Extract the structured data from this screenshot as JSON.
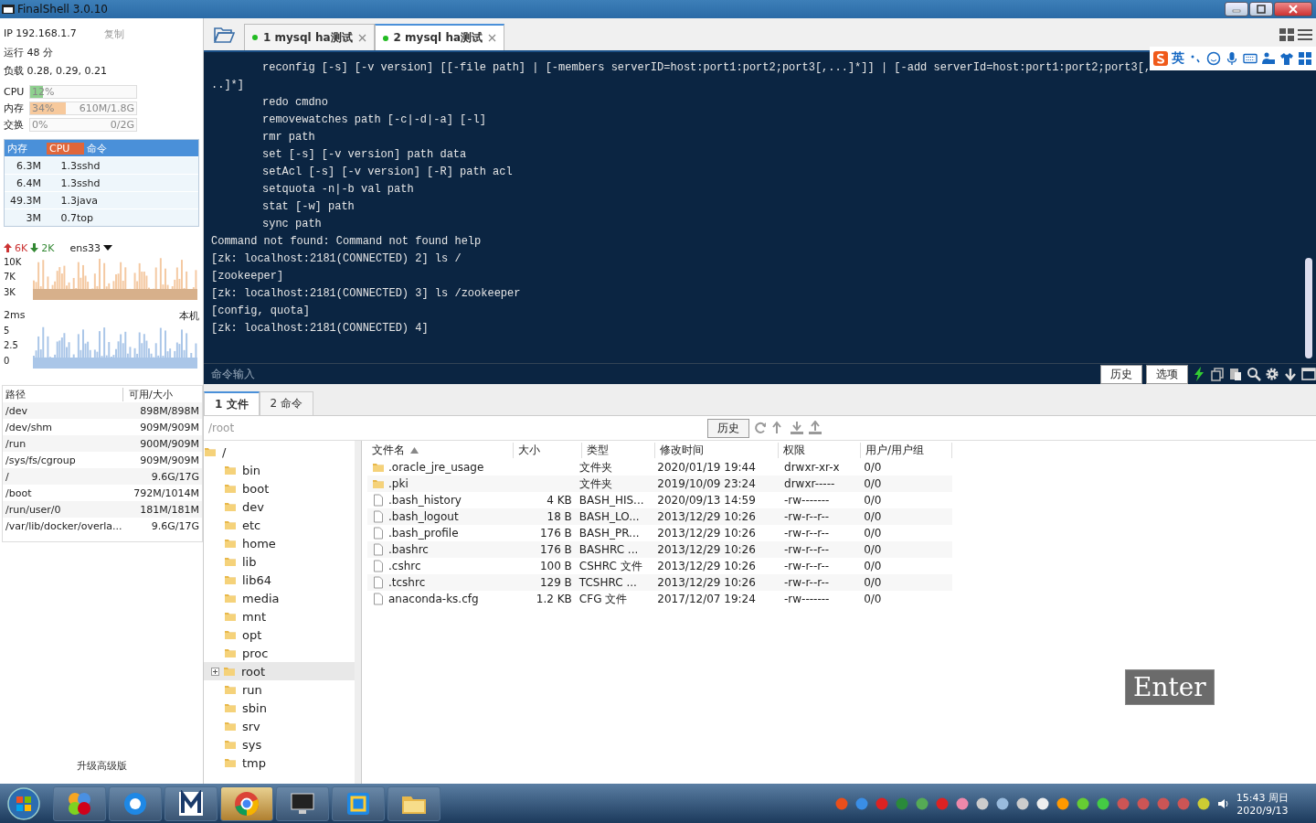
{
  "window": {
    "title": "FinalShell 3.0.10"
  },
  "sidebar": {
    "ip": "IP 192.168.1.7",
    "copy_button": "复制",
    "uptime": "运行 48 分",
    "load": "负载 0.28, 0.29, 0.21",
    "meters": [
      {
        "label": "CPU",
        "level": 0.12,
        "percent": "12%",
        "color": "#8fd08f"
      },
      {
        "label": "内存",
        "level": 0.34,
        "percent": "34%",
        "detail": "610M/1.8G",
        "color": "#f7c99c"
      },
      {
        "label": "交换",
        "percent": "0%",
        "detail": "0/2G"
      }
    ],
    "process_table": {
      "columns": [
        {
          "label": "内存",
          "selected": false
        },
        {
          "label": "CPU",
          "selected": true
        },
        {
          "label": "命令",
          "selected": false
        }
      ],
      "rows": [
        [
          "6.3M",
          "1.3",
          "sshd"
        ],
        [
          "6.4M",
          "1.3",
          "sshd"
        ],
        [
          "49.3M",
          "1.3",
          "java"
        ],
        [
          "3M",
          "0.7",
          "top"
        ]
      ]
    },
    "network": {
      "upload": "6K",
      "download": "2K",
      "interface": "ens33",
      "ticks": [
        "10K",
        "7K",
        "3K"
      ]
    },
    "latency": {
      "value": "2ms",
      "host": "本机",
      "ticks": [
        "5",
        "2.5",
        "0"
      ]
    },
    "disk_table": {
      "columns": [
        "路径",
        "可用/大小"
      ],
      "rows": [
        [
          "/dev",
          "898M/898M"
        ],
        [
          "/dev/shm",
          "909M/909M"
        ],
        [
          "/run",
          "900M/909M"
        ],
        [
          "/sys/fs/cgroup",
          "909M/909M"
        ],
        [
          "/",
          "9.6G/17G"
        ],
        [
          "/boot",
          "792M/1014M"
        ],
        [
          "/run/user/0",
          "181M/181M"
        ],
        [
          "/var/lib/docker/overla...",
          "9.6G/17G"
        ]
      ]
    },
    "upgrade_link": "升级高级版"
  },
  "tabs": [
    {
      "label": "1 mysql ha测试",
      "selected": false
    },
    {
      "label": "2 mysql ha测试",
      "selected": true
    }
  ],
  "terminal": {
    "lines": [
      {
        "text": "reconfig [-s] [-v version] [[-file path] | [-members serverID=host:port1:port2;port3[,...]*]] | [-add serverId=host:port1:port2;port3[,",
        "indent": true
      },
      {
        "text": "..]*]",
        "indent": false
      },
      {
        "text": "redo cmdno",
        "indent": true
      },
      {
        "text": "removewatches path [-c|-d|-a] [-l]",
        "indent": true
      },
      {
        "text": "rmr path",
        "indent": true
      },
      {
        "text": "set [-s] [-v version] path data",
        "indent": true
      },
      {
        "text": "setAcl [-s] [-v version] [-R] path acl",
        "indent": true
      },
      {
        "text": "setquota -n|-b val path",
        "indent": true
      },
      {
        "text": "stat [-w] path",
        "indent": true
      },
      {
        "text": "sync path",
        "indent": true
      },
      {
        "text": "Command not found: Command not found help",
        "indent": false
      },
      {
        "text": "[zk: localhost:2181(CONNECTED) 2] ls /",
        "indent": false
      },
      {
        "text": "[zookeeper]",
        "indent": false
      },
      {
        "text": "[zk: localhost:2181(CONNECTED) 3] ls /zookeeper",
        "indent": false
      },
      {
        "text": "[config, quota]",
        "indent": false
      },
      {
        "text": "[zk: localhost:2181(CONNECTED) 4]",
        "indent": false
      }
    ],
    "ime_label": "英",
    "command_placeholder": "命令输入",
    "history_button": "历史",
    "options_button": "选项"
  },
  "bottom_tabs": [
    {
      "label": "1 文件",
      "selected": true
    },
    {
      "label": "2 命令",
      "selected": false
    }
  ],
  "path_bar": {
    "value": "/root",
    "history_button": "历史"
  },
  "tree": {
    "root": "/",
    "children": [
      {
        "name": "bin",
        "selected": false
      },
      {
        "name": "boot",
        "selected": false
      },
      {
        "name": "dev",
        "selected": false
      },
      {
        "name": "etc",
        "selected": false
      },
      {
        "name": "home",
        "selected": false
      },
      {
        "name": "lib",
        "selected": false
      },
      {
        "name": "lib64",
        "selected": false
      },
      {
        "name": "media",
        "selected": false
      },
      {
        "name": "mnt",
        "selected": false
      },
      {
        "name": "opt",
        "selected": false
      },
      {
        "name": "proc",
        "selected": false
      },
      {
        "name": "root",
        "selected": true
      },
      {
        "name": "run",
        "selected": false
      },
      {
        "name": "sbin",
        "selected": false
      },
      {
        "name": "srv",
        "selected": false
      },
      {
        "name": "sys",
        "selected": false
      },
      {
        "name": "tmp",
        "selected": false
      }
    ]
  },
  "file_table": {
    "columns": [
      "文件名",
      "大小",
      "类型",
      "修改时间",
      "权限",
      "用户/用户组"
    ],
    "rows": [
      {
        "kind": "folder",
        "cells": [
          ".oracle_jre_usage",
          "",
          "文件夹",
          "2020/01/19 19:44",
          "drwxr-xr-x",
          "0/0"
        ]
      },
      {
        "kind": "folder",
        "cells": [
          ".pki",
          "",
          "文件夹",
          "2019/10/09 23:24",
          "drwxr-----",
          "0/0"
        ]
      },
      {
        "kind": "file",
        "cells": [
          ".bash_history",
          "4 KB",
          "BASH_HIS...",
          "2020/09/13 14:59",
          "-rw-------",
          "0/0"
        ]
      },
      {
        "kind": "file",
        "cells": [
          ".bash_logout",
          "18 B",
          "BASH_LO...",
          "2013/12/29 10:26",
          "-rw-r--r--",
          "0/0"
        ]
      },
      {
        "kind": "file",
        "cells": [
          ".bash_profile",
          "176 B",
          "BASH_PR...",
          "2013/12/29 10:26",
          "-rw-r--r--",
          "0/0"
        ]
      },
      {
        "kind": "file",
        "cells": [
          ".bashrc",
          "176 B",
          "BASHRC ...",
          "2013/12/29 10:26",
          "-rw-r--r--",
          "0/0"
        ]
      },
      {
        "kind": "file",
        "cells": [
          ".cshrc",
          "100 B",
          "CSHRC 文件",
          "2013/12/29 10:26",
          "-rw-r--r--",
          "0/0"
        ]
      },
      {
        "kind": "file",
        "cells": [
          ".tcshrc",
          "129 B",
          "TCSHRC ...",
          "2013/12/29 10:26",
          "-rw-r--r--",
          "0/0"
        ]
      },
      {
        "kind": "file",
        "cells": [
          "anaconda-ks.cfg",
          "1.2 KB",
          "CFG 文件",
          "2017/12/07 19:24",
          "-rw-------",
          "0/0"
        ]
      }
    ]
  },
  "key_overlay": "Enter",
  "taskbar": {
    "apps": [
      {
        "kind": "pinwheel",
        "selected": false
      },
      {
        "kind": "cloud",
        "selected": false
      },
      {
        "kind": "letter",
        "selected": false
      },
      {
        "kind": "chrome",
        "selected": true
      },
      {
        "kind": "monitor",
        "selected": false
      },
      {
        "kind": "vm",
        "selected": false
      },
      {
        "kind": "folder",
        "selected": false
      }
    ],
    "time": "15:43 周日",
    "date": "2020/9/13"
  }
}
